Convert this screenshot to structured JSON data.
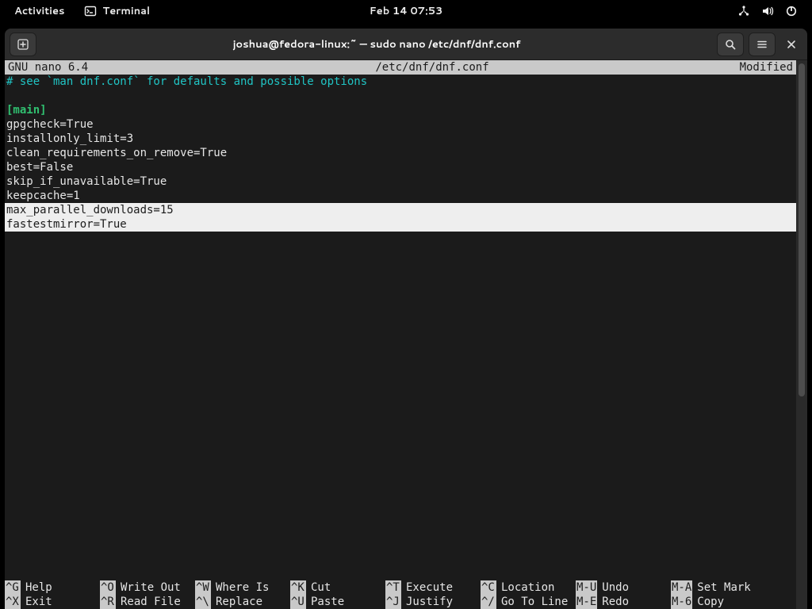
{
  "topbar": {
    "activities": "Activities",
    "app_label": "Terminal",
    "clock": "Feb 14  07:53"
  },
  "window": {
    "title": "joshua@fedora-linux:~ — sudo nano /etc/dnf/dnf.conf"
  },
  "nano": {
    "version": " GNU nano 6.4",
    "filename": "/etc/dnf/dnf.conf",
    "status": "Modified"
  },
  "file": {
    "comment": "# see `man dnf.conf` for defaults and possible options",
    "section": "[main]",
    "lines": [
      "gpgcheck=True",
      "installonly_limit=3",
      "clean_requirements_on_remove=True",
      "best=False",
      "skip_if_unavailable=True",
      "keepcache=1"
    ],
    "selected": [
      "max_parallel_downloads=15",
      "fastestmirror=True"
    ]
  },
  "help": {
    "row1": [
      {
        "k": "^G",
        "l": "Help"
      },
      {
        "k": "^O",
        "l": "Write Out"
      },
      {
        "k": "^W",
        "l": "Where Is"
      },
      {
        "k": "^K",
        "l": "Cut"
      },
      {
        "k": "^T",
        "l": "Execute"
      },
      {
        "k": "^C",
        "l": "Location"
      },
      {
        "k": "M-U",
        "l": "Undo"
      },
      {
        "k": "M-A",
        "l": "Set Mark"
      }
    ],
    "row2": [
      {
        "k": "^X",
        "l": "Exit"
      },
      {
        "k": "^R",
        "l": "Read File"
      },
      {
        "k": "^\\",
        "l": "Replace"
      },
      {
        "k": "^U",
        "l": "Paste"
      },
      {
        "k": "^J",
        "l": "Justify"
      },
      {
        "k": "^/",
        "l": "Go To Line"
      },
      {
        "k": "M-E",
        "l": "Redo"
      },
      {
        "k": "M-6",
        "l": "Copy"
      }
    ]
  }
}
